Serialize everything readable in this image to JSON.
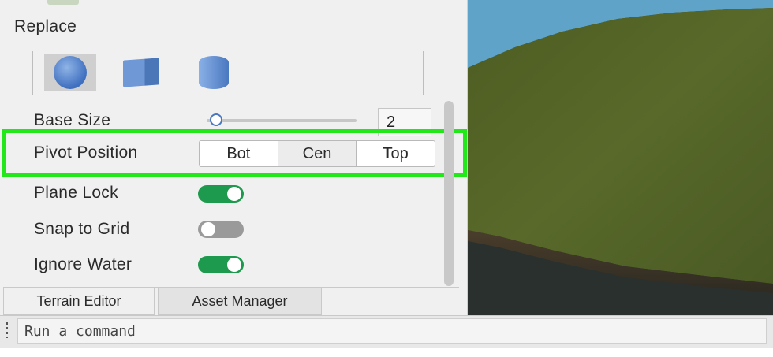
{
  "terrain_panel": {
    "section_title": "Replace",
    "shapes": [
      {
        "icon": "sphere-icon",
        "selected": true
      },
      {
        "icon": "cube-icon",
        "selected": false
      },
      {
        "icon": "cylinder-icon",
        "selected": false
      }
    ],
    "base_size": {
      "label": "Base Size",
      "value": "2",
      "slider_fraction": 0.03
    },
    "pivot_position": {
      "label": "Pivot Position",
      "options": [
        "Bot",
        "Cen",
        "Top"
      ]
    },
    "plane_lock": {
      "label": "Plane Lock",
      "on": true
    },
    "snap_to_grid": {
      "label": "Snap to Grid",
      "on": false
    },
    "ignore_water": {
      "label": "Ignore Water",
      "on": true
    }
  },
  "tabs": [
    {
      "label": "Terrain Editor",
      "active": true
    },
    {
      "label": "Asset Manager",
      "active": false
    }
  ],
  "command_bar": {
    "placeholder": "Run a command"
  },
  "colors": {
    "highlight": "#22e81a",
    "toggle_on": "#1e9a4e",
    "toggle_off": "#9a9a9a",
    "accent": "#4a78c0"
  }
}
